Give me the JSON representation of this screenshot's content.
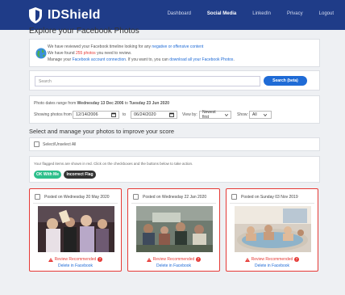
{
  "app": {
    "brand": "IDShield",
    "nav": [
      {
        "label": "Dashboard",
        "active": false
      },
      {
        "label": "Social Media",
        "active": true
      },
      {
        "label": "LinkedIn",
        "active": false
      },
      {
        "label": "Privacy",
        "active": false
      },
      {
        "label": "Logout",
        "active": false
      }
    ]
  },
  "page": {
    "title": "Explore your Facebook Photos",
    "info": {
      "line1_pre": "We have reviewed your Facebook timeline looking for any ",
      "line1_link": "negative or offensive content",
      "line2_pre": "We have found ",
      "line2_count": "255 photos",
      "line2_post": " you need to review.",
      "line3_pre": "Manage your ",
      "line3_link1": "Facebook account connection",
      "line3_mid": ". If you want to, you can ",
      "line3_link2": "download all your Facebook Photos",
      "line3_end": "."
    },
    "search": {
      "placeholder": "Search",
      "button": "Search (beta)"
    },
    "dates": {
      "range_pre": "Photo dates range from ",
      "range_from": "Wednesday 13 Dec 2006",
      "range_mid": " to ",
      "range_to": "Tuesday 23 Jun 2020",
      "showing_label": "Showing photos from",
      "from_value": "12/14/2006",
      "to_label": "to",
      "to_value": "06/24/2020",
      "view_label": "View by:",
      "view_value": "Newest first",
      "show_label": "Show:",
      "show_value": "All"
    },
    "manage_title": "Select and manage your photos to improve your score",
    "select_all": "Select/Unselect All",
    "flag": {
      "note": "Your flagged items are shown in red. Click on the checkboxes and the buttons below to take action.",
      "ok_button": "OK With Me",
      "incorrect_button": "Incorrect Flag"
    },
    "photos": [
      {
        "posted": "Posted on Wednesday 20 May 2020",
        "review": "Review Recommended",
        "delete": "Delete in Facebook"
      },
      {
        "posted": "Posted on Wednesday 22 Jan 2020",
        "review": "Review Recommended",
        "delete": "Delete in Facebook"
      },
      {
        "posted": "Posted on Sunday 03 Nov 2019",
        "review": "Review Recommended",
        "delete": "Delete in Facebook"
      }
    ]
  },
  "colors": {
    "header": "#1f3c88",
    "accent": "#1f6bd6",
    "flag": "#e53935",
    "ok": "#2dbf8c"
  },
  "icons": [
    "shield-icon",
    "earth-icon",
    "calendar-icon",
    "chevron-down-icon",
    "warning-icon",
    "help-icon"
  ]
}
